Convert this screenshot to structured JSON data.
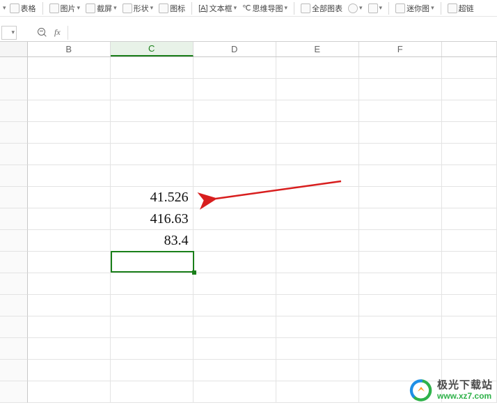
{
  "ribbon": {
    "items": [
      {
        "label": "表格"
      },
      {
        "label": "图片"
      },
      {
        "label": "截屏"
      },
      {
        "label": "形状"
      },
      {
        "label": "图标"
      },
      {
        "label": "文本框"
      },
      {
        "label": "思维导图"
      },
      {
        "label": "全部图表"
      },
      {
        "label": "迷你图"
      },
      {
        "label": "超链"
      }
    ],
    "textbox_prefix": "[A]",
    "mindmap_prefix": "℃"
  },
  "formula_bar": {
    "fx_label": "fx",
    "input_value": ""
  },
  "columns": [
    "B",
    "C",
    "D",
    "E",
    "F"
  ],
  "active_column": "C",
  "cells": {
    "C7": "41.526",
    "C8": "416.63",
    "C9": "83.4"
  },
  "active_cell": "C10",
  "watermark": {
    "title": "极光下载站",
    "url": "www.xz7.com"
  }
}
